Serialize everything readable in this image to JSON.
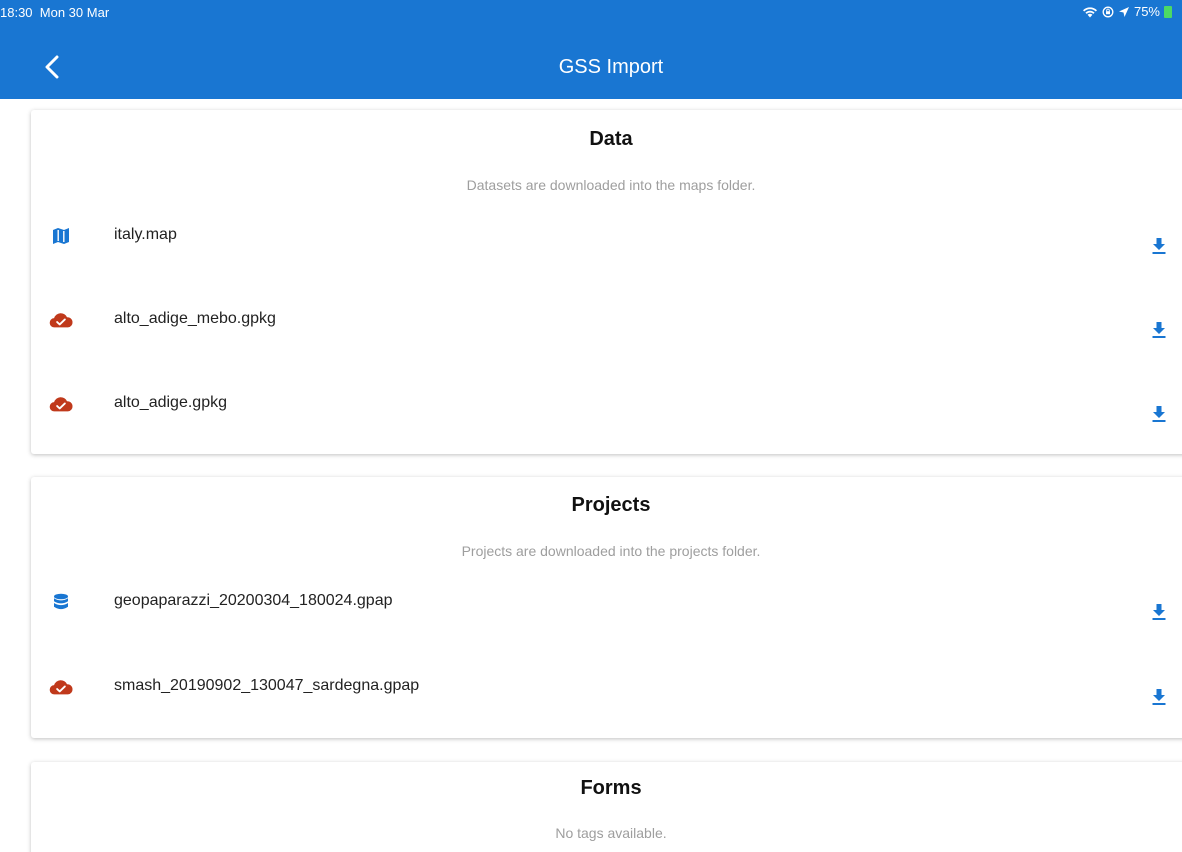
{
  "status_bar": {
    "time": "18:30",
    "date": "Mon 30 Mar",
    "battery_percent": "75%",
    "icons": [
      "wifi-icon",
      "lock-rotation-icon",
      "location-icon",
      "battery-icon"
    ]
  },
  "header": {
    "title": "GSS Import",
    "back_icon": "back-chevron-icon"
  },
  "colors": {
    "appbar": "#1976d2",
    "accent_blue": "#1976d2",
    "cloud_red": "#c0391b",
    "subtitle_gray": "#9e9e9e"
  },
  "sections": [
    {
      "title": "Data",
      "subtitle": "Datasets are downloaded into the maps folder.",
      "items": [
        {
          "label": "italy.map",
          "icon": "map-icon"
        },
        {
          "label": "alto_adige_mebo.gpkg",
          "icon": "cloud-check-icon"
        },
        {
          "label": "alto_adige.gpkg",
          "icon": "cloud-check-icon"
        }
      ]
    },
    {
      "title": "Projects",
      "subtitle": "Projects are downloaded into the projects folder.",
      "items": [
        {
          "label": "geopaparazzi_20200304_180024.gpap",
          "icon": "database-icon"
        },
        {
          "label": "smash_20190902_130047_sardegna.gpap",
          "icon": "cloud-check-icon"
        }
      ]
    },
    {
      "title": "Forms",
      "subtitle": "No tags available.",
      "items": []
    }
  ],
  "row_action_icon": "download-icon"
}
